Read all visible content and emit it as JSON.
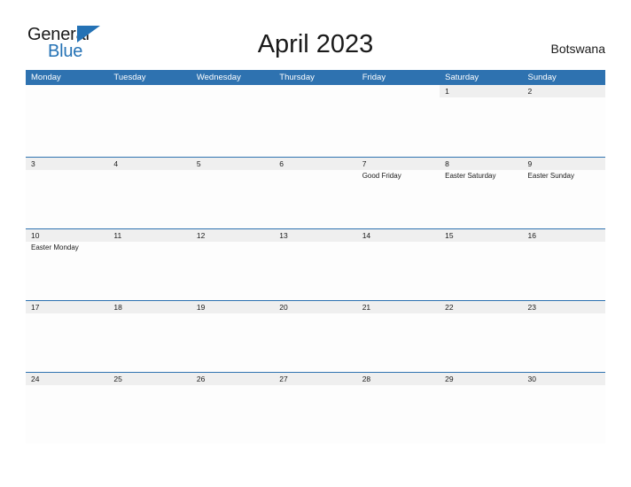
{
  "brand": {
    "name_part1": "General",
    "name_part2": "Blue",
    "triangle_icon": "blue-triangle-icon",
    "color_dark": "#1a1a1a",
    "color_blue": "#2472b5"
  },
  "header": {
    "title": "April 2023",
    "country": "Botswana"
  },
  "theme": {
    "header_blue": "#2e72b0",
    "band_gray": "#efefef",
    "cell_white": "#fdfdfd",
    "text": "#1a1a1a"
  },
  "calendar": {
    "weekday_headers": [
      "Monday",
      "Tuesday",
      "Wednesday",
      "Thursday",
      "Friday",
      "Saturday",
      "Sunday"
    ],
    "weeks": [
      [
        {
          "date": "",
          "event": ""
        },
        {
          "date": "",
          "event": ""
        },
        {
          "date": "",
          "event": ""
        },
        {
          "date": "",
          "event": ""
        },
        {
          "date": "",
          "event": ""
        },
        {
          "date": "1",
          "event": ""
        },
        {
          "date": "2",
          "event": ""
        }
      ],
      [
        {
          "date": "3",
          "event": ""
        },
        {
          "date": "4",
          "event": ""
        },
        {
          "date": "5",
          "event": ""
        },
        {
          "date": "6",
          "event": ""
        },
        {
          "date": "7",
          "event": "Good Friday"
        },
        {
          "date": "8",
          "event": "Easter Saturday"
        },
        {
          "date": "9",
          "event": "Easter Sunday"
        }
      ],
      [
        {
          "date": "10",
          "event": "Easter Monday"
        },
        {
          "date": "11",
          "event": ""
        },
        {
          "date": "12",
          "event": ""
        },
        {
          "date": "13",
          "event": ""
        },
        {
          "date": "14",
          "event": ""
        },
        {
          "date": "15",
          "event": ""
        },
        {
          "date": "16",
          "event": ""
        }
      ],
      [
        {
          "date": "17",
          "event": ""
        },
        {
          "date": "18",
          "event": ""
        },
        {
          "date": "19",
          "event": ""
        },
        {
          "date": "20",
          "event": ""
        },
        {
          "date": "21",
          "event": ""
        },
        {
          "date": "22",
          "event": ""
        },
        {
          "date": "23",
          "event": ""
        }
      ],
      [
        {
          "date": "24",
          "event": ""
        },
        {
          "date": "25",
          "event": ""
        },
        {
          "date": "26",
          "event": ""
        },
        {
          "date": "27",
          "event": ""
        },
        {
          "date": "28",
          "event": ""
        },
        {
          "date": "29",
          "event": ""
        },
        {
          "date": "30",
          "event": ""
        }
      ]
    ]
  }
}
